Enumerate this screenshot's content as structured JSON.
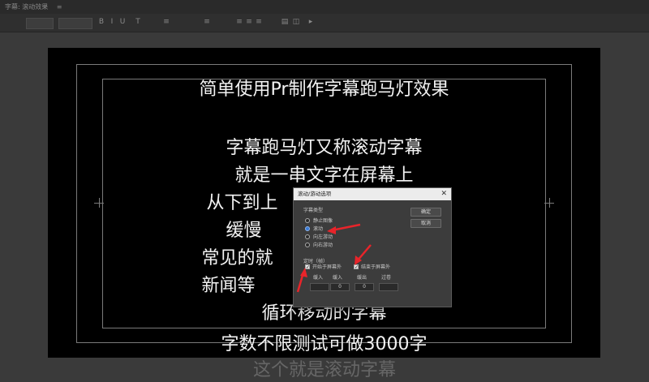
{
  "window": {
    "title": "字幕: 滚动效果",
    "tab_close": "≡"
  },
  "subtitle_lines": [
    "简单使用Pr制作字幕跑马灯效果",
    "字幕跑马灯又称滚动字幕",
    "就是一串文字在屏幕上",
    "从下到上",
    "缓慢",
    "常见的就",
    "新闻等",
    "循环移动的字幕",
    "字数不限测试可做3000字"
  ],
  "below_text": "这个就是滚动字幕",
  "dialog": {
    "title": "滚动/游动选项",
    "close": "✕",
    "ok_label": "确定",
    "cancel_label": "取消",
    "type_group_label": "字幕类型",
    "options": [
      "静止图像",
      "滚动",
      "向左游动",
      "向右游动"
    ],
    "selected_option": "滚动",
    "timing_label": "定时（帧）",
    "start_offscreen": "开始于屏幕外",
    "end_offscreen": "结束于屏幕外",
    "fields": [
      {
        "label": "缓入",
        "value": ""
      },
      {
        "label": "缓入",
        "value": "0"
      },
      {
        "label": "缓出",
        "value": "0"
      },
      {
        "label": "过卷",
        "value": ""
      }
    ]
  },
  "colors": {
    "accent": "#3a7bd5",
    "arrow": "#e8242a"
  }
}
